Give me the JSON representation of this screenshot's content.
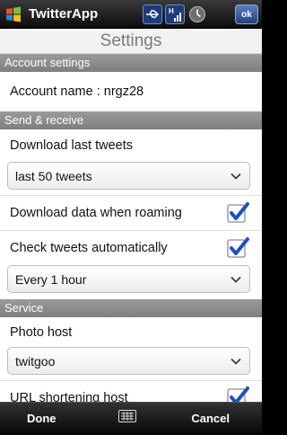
{
  "statusbar": {
    "app_title": "TwitterApp",
    "ok_label": "ok",
    "icons": [
      "windows-start-icon",
      "usb-icon",
      "signal-icon",
      "clock-icon"
    ]
  },
  "page": {
    "title": "Settings"
  },
  "sections": {
    "account": {
      "header": "Account settings",
      "account_name_label": "Account name : nrgz28"
    },
    "send_receive": {
      "header": "Send & receive",
      "download_label": "Download last tweets",
      "download_value": "last 50 tweets",
      "roaming_label": "Download data when roaming",
      "roaming_checked": true,
      "auto_check_label": "Check tweets automatically",
      "auto_check_checked": true,
      "interval_value": "Every 1 hour"
    },
    "service": {
      "header": "Service",
      "photo_host_label": "Photo host",
      "photo_host_value": "twitgoo",
      "url_shortening_label": "URL shortening host",
      "url_shortening_checked": true
    }
  },
  "softkeys": {
    "left_label": "Done",
    "right_label": "Cancel"
  },
  "colors": {
    "section_header": "#8c8c8c",
    "checkmark": "#1d4fc2",
    "ok_button": "#3b5ea3"
  }
}
